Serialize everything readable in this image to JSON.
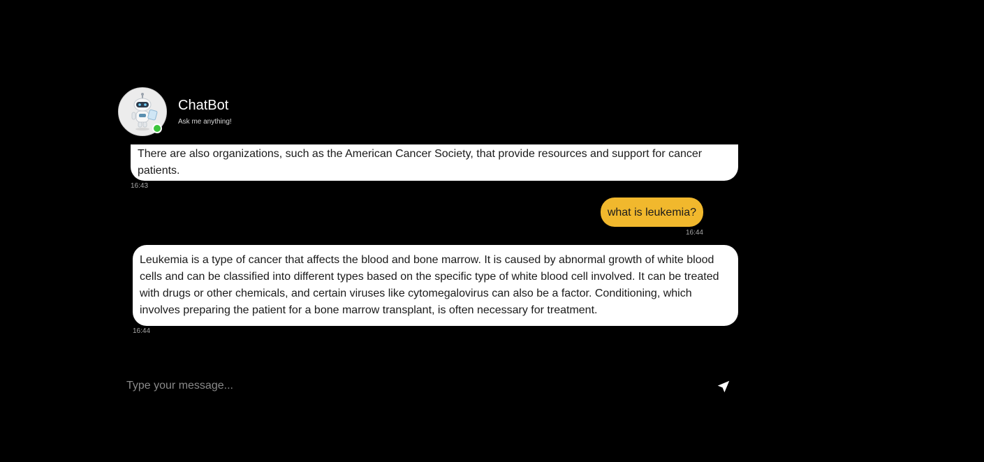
{
  "header": {
    "bot_name": "ChatBot",
    "subtitle": "Ask me anything!",
    "status_color": "#3cc43c"
  },
  "messages": [
    {
      "role": "bot",
      "text": "There are also organizations, such as the American Cancer Society, that provide resources and support for cancer patients.",
      "time": "16:43"
    },
    {
      "role": "user",
      "text": "what is leukemia?",
      "time": "16:44"
    },
    {
      "role": "bot",
      "text": "Leukemia is a type of cancer that affects the blood and bone marrow. It is caused by abnormal growth of white blood cells and can be classified into different types based on the specific type of white blood cell involved. It can be treated with drugs or other chemicals, and certain viruses like cytomegalovirus can also be a factor. Conditioning, which involves preparing the patient for a bone marrow transplant, is often necessary for treatment.",
      "time": "16:44"
    }
  ],
  "composer": {
    "placeholder": "Type your message...",
    "value": "",
    "send_icon": "send-arrow-icon"
  },
  "colors": {
    "background": "#000000",
    "bot_bubble": "#ffffff",
    "user_bubble": "#f1b82d"
  }
}
